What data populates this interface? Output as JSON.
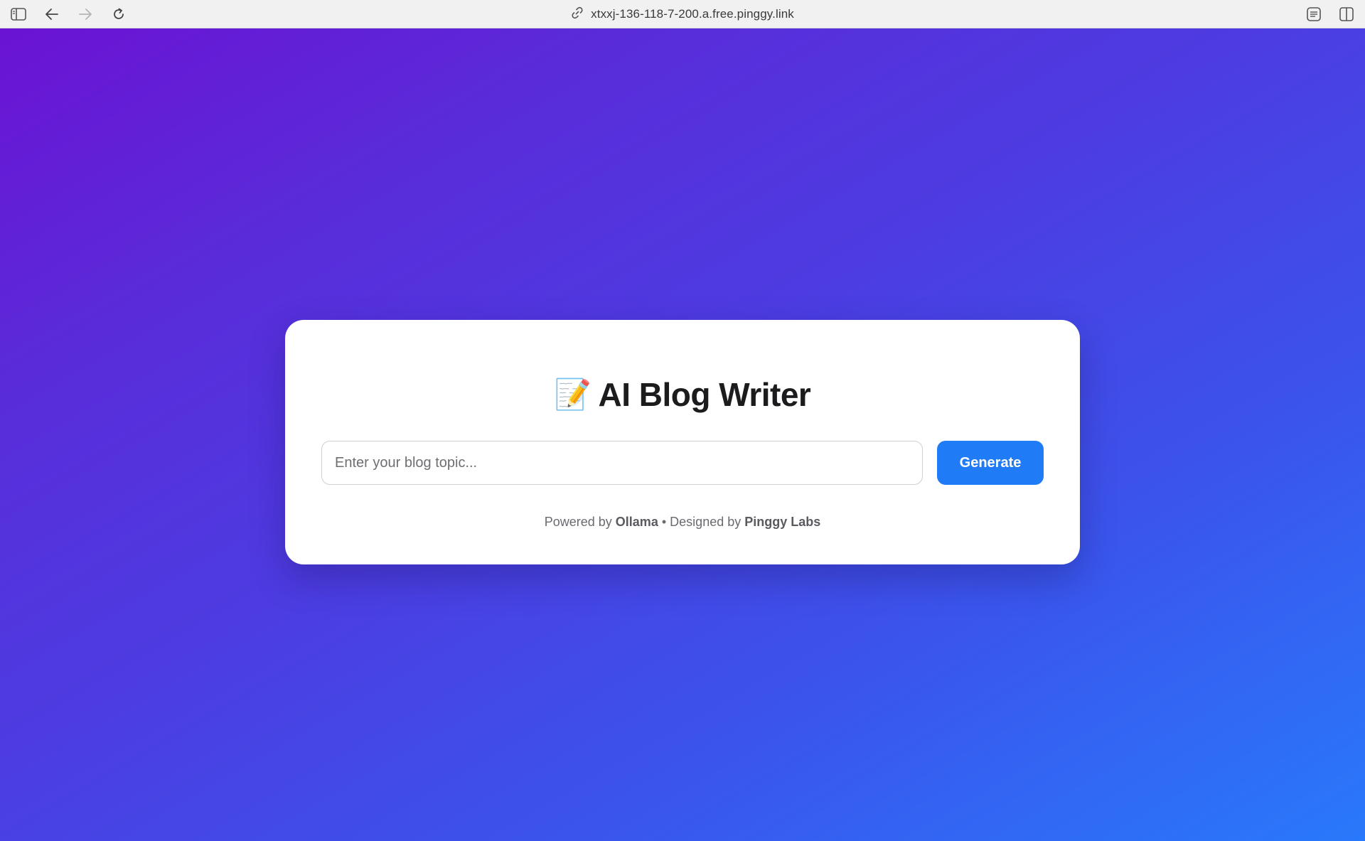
{
  "browser": {
    "url": "xtxxj-136-118-7-200.a.free.pinggy.link",
    "icons": [
      "sidebar-icon",
      "back-arrow-icon",
      "forward-arrow-icon",
      "reload-icon",
      "link-icon",
      "reader-icon",
      "split-view-icon"
    ]
  },
  "page": {
    "title_emoji": "📝",
    "title": "AI Blog Writer",
    "input_placeholder": "Enter your blog topic...",
    "input_value": "",
    "button_label": "Generate",
    "footer": {
      "powered_prefix": "Powered by",
      "powered_name": "Ollama",
      "separator": "•",
      "designed_prefix": "Designed by",
      "designed_name": "Pinggy Labs"
    }
  },
  "colors": {
    "gradient_start": "#6b13d3",
    "gradient_end": "#2979fb",
    "button": "#1f7bf6",
    "card": "#ffffff"
  }
}
